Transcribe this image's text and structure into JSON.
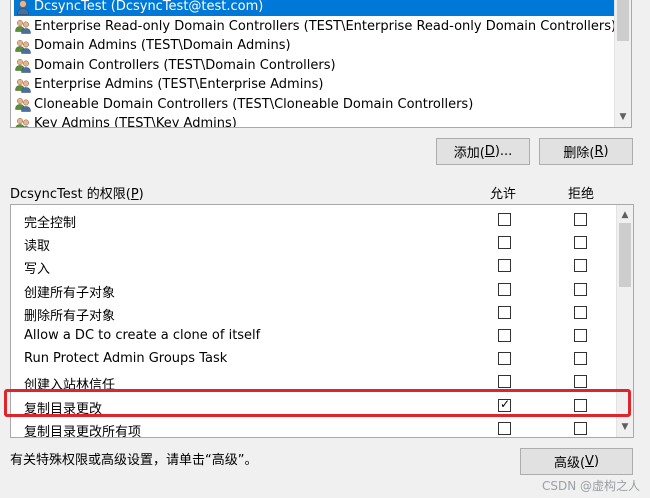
{
  "principals": {
    "items": [
      {
        "label": "DcsyncTest (DcsyncTest@test.com)",
        "icon": "user-icon",
        "selected": true
      },
      {
        "label": "Enterprise Read-only Domain Controllers (TEST\\Enterprise Read-only Domain Controllers)",
        "icon": "group-icon",
        "selected": false
      },
      {
        "label": "Domain Admins (TEST\\Domain Admins)",
        "icon": "group-icon",
        "selected": false
      },
      {
        "label": "Domain Controllers (TEST\\Domain Controllers)",
        "icon": "group-icon",
        "selected": false
      },
      {
        "label": "Enterprise Admins (TEST\\Enterprise Admins)",
        "icon": "group-icon",
        "selected": false
      },
      {
        "label": "Cloneable Domain Controllers (TEST\\Cloneable Domain Controllers)",
        "icon": "group-icon",
        "selected": false
      },
      {
        "label": "Key Admins (TEST\\Key Admins)",
        "icon": "group-icon",
        "selected": false
      }
    ]
  },
  "buttons": {
    "add": {
      "text": "添加(",
      "mnemonic": "D",
      "suffix": ")..."
    },
    "remove": {
      "text": "删除(",
      "mnemonic": "R",
      "suffix": ")"
    },
    "advanced": {
      "text": "高级(",
      "mnemonic": "V",
      "suffix": ")"
    }
  },
  "permissions": {
    "label_prefix": "DcsyncTest 的权限(",
    "label_mnemonic": "P",
    "label_suffix": ")",
    "allow_header": "允许",
    "deny_header": "拒绝",
    "items": [
      {
        "name": "完全控制",
        "allow": false,
        "deny": false
      },
      {
        "name": "读取",
        "allow": false,
        "deny": false
      },
      {
        "name": "写入",
        "allow": false,
        "deny": false
      },
      {
        "name": "创建所有子对象",
        "allow": false,
        "deny": false
      },
      {
        "name": "删除所有子对象",
        "allow": false,
        "deny": false
      },
      {
        "name": "Allow a DC to create a clone of itself",
        "allow": false,
        "deny": false
      },
      {
        "name": "Run Protect Admin Groups Task",
        "allow": false,
        "deny": false
      },
      {
        "name": "创建入站林信任",
        "allow": false,
        "deny": false
      },
      {
        "name": "复制目录更改",
        "allow": true,
        "deny": false
      },
      {
        "name": "复制目录更改所有项",
        "allow": false,
        "deny": false
      }
    ]
  },
  "advanced_hint": "有关特殊权限或高级设置，请单击“高级”。",
  "watermark": "CSDN @虚构之人",
  "colors": {
    "selection": "#0078d7",
    "highlight_box": "#e0242b"
  }
}
